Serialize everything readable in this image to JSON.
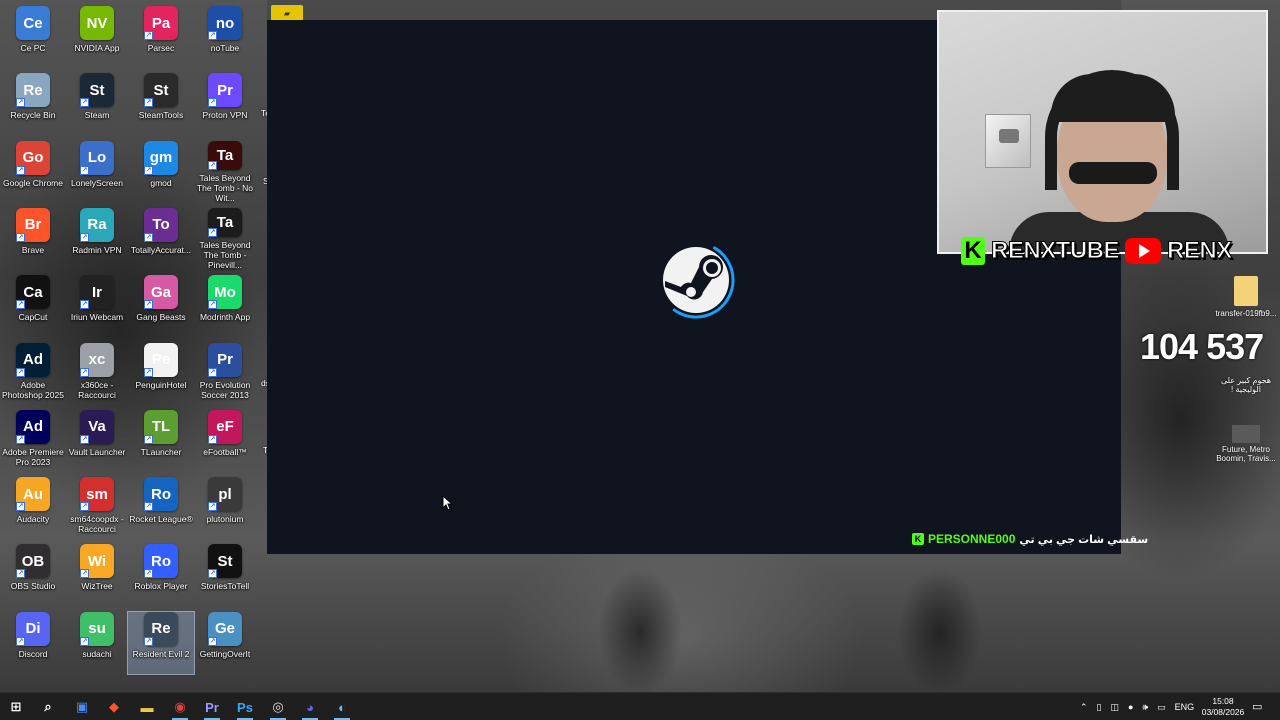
{
  "desktop": {
    "icons": [
      {
        "label": "Ce PC",
        "icon": "computer-icon",
        "color": "#3a7bd5"
      },
      {
        "label": "NVIDIA App",
        "icon": "nvidia-icon",
        "color": "#76b900"
      },
      {
        "label": "Parsec",
        "icon": "parsec-icon",
        "color": "#e3245e"
      },
      {
        "label": "noTube",
        "icon": "notube-icon",
        "color": "#1e4fa8"
      },
      {
        "label": "Recycle Bin",
        "icon": "recycle-bin-icon",
        "color": "#8aa6c1"
      },
      {
        "label": "Steam",
        "icon": "steam-icon",
        "color": "#1b2838"
      },
      {
        "label": "SteamTools",
        "icon": "steamtools-icon",
        "color": "#2a2a2a"
      },
      {
        "label": "Proton VPN",
        "icon": "proton-vpn-icon",
        "color": "#6d4aff"
      },
      {
        "label": "Google Chrome",
        "icon": "chrome-icon",
        "color": "#db4437"
      },
      {
        "label": "LonelyScreen",
        "icon": "lonelyscreen-icon",
        "color": "#3c6fc8"
      },
      {
        "label": "gmod",
        "icon": "gmod-icon",
        "color": "#1e88e5"
      },
      {
        "label": "Tales Beyond The Tomb - No Wit...",
        "icon": "tbtt-icon",
        "color": "#3a0b0b"
      },
      {
        "label": "Brave",
        "icon": "brave-icon",
        "color": "#fb542b"
      },
      {
        "label": "Radmin VPN",
        "icon": "radmin-vpn-icon",
        "color": "#29a8b8"
      },
      {
        "label": "TotallyAccurat...",
        "icon": "tabs-icon",
        "color": "#6a2d91"
      },
      {
        "label": "Tales Beyond The Tomb - Pinevill...",
        "icon": "tbtt-ep1-icon",
        "color": "#1c1c1c"
      },
      {
        "label": "CapCut",
        "icon": "capcut-icon",
        "color": "#111111"
      },
      {
        "label": "Iriun Webcam",
        "icon": "iriun-webcam-icon",
        "color": "#222222"
      },
      {
        "label": "Gang Beasts",
        "icon": "gang-beasts-icon",
        "color": "#d65aa3"
      },
      {
        "label": "Modrinth App",
        "icon": "modrinth-icon",
        "color": "#1bd96a"
      },
      {
        "label": "Adobe Photoshop 2025",
        "icon": "photoshop-icon",
        "color": "#001e36"
      },
      {
        "label": "x360ce - Raccourci",
        "icon": "gamepad-icon",
        "color": "#9aa0a6"
      },
      {
        "label": "PenguinHotel",
        "icon": "penguinhotel-icon",
        "color": "#f2f2f2"
      },
      {
        "label": "Pro Evolution Soccer 2013",
        "icon": "pes2013-icon",
        "color": "#2b4f9e"
      },
      {
        "label": "Adobe Premiere Pro 2023",
        "icon": "premiere-icon",
        "color": "#00005b"
      },
      {
        "label": "Vault Launcher",
        "icon": "vault-launcher-icon",
        "color": "#2b1b55"
      },
      {
        "label": "TLauncher",
        "icon": "tlauncher-icon",
        "color": "#5c9e31"
      },
      {
        "label": "eFootball™",
        "icon": "efootball-icon",
        "color": "#c2185b"
      },
      {
        "label": "Audacity",
        "icon": "audacity-icon",
        "color": "#f5a623"
      },
      {
        "label": "sm64coopdx - Raccourci",
        "icon": "sm64-icon",
        "color": "#d32f2f"
      },
      {
        "label": "Rocket League®",
        "icon": "rocket-league-icon",
        "color": "#1565c0"
      },
      {
        "label": "plutonium",
        "icon": "plutonium-icon",
        "color": "#3a3a3a"
      },
      {
        "label": "OBS Studio",
        "icon": "obs-icon",
        "color": "#302e31"
      },
      {
        "label": "WizTree",
        "icon": "wiztree-icon",
        "color": "#f9a825"
      },
      {
        "label": "Roblox Player",
        "icon": "roblox-icon",
        "color": "#335fff"
      },
      {
        "label": "StoriesToTell",
        "icon": "unreal-icon",
        "color": "#111111"
      },
      {
        "label": "Discord",
        "icon": "discord-icon",
        "color": "#5865f2"
      },
      {
        "label": "sudachi",
        "icon": "sudachi-icon",
        "color": "#3fbf68"
      },
      {
        "label": "Resident Evil 2",
        "icon": "resident-evil-2-icon",
        "color": "#3b4a5a"
      },
      {
        "label": "GettingOverIt",
        "icon": "getting-over-it-icon",
        "color": "#4a90c2"
      }
    ],
    "cut_labels": [
      "Te",
      "S",
      "ds",
      "T"
    ],
    "right_icons": [
      {
        "label": "transfer-019fb9...",
        "icon": "folder-icon"
      },
      {
        "label": "هجوم كبير على الوليجية !",
        "icon": "video-file-icon"
      },
      {
        "label": "Future, Metro Boomin, Travis...",
        "icon": "image-file-icon"
      }
    ]
  },
  "stream": {
    "banner_left": "RENXTUBE",
    "banner_right": "RENX",
    "counter": "104 537",
    "chat_user": "PERSONNE000",
    "chat_message": "سقسي شات جي بي تي"
  },
  "taskbar": {
    "apps": [
      {
        "name": "start",
        "icon": "windows-start-icon"
      },
      {
        "name": "search",
        "icon": "search-icon"
      },
      {
        "name": "store",
        "icon": "store-icon"
      },
      {
        "name": "brave",
        "icon": "brave-icon"
      },
      {
        "name": "files",
        "icon": "folder-icon"
      },
      {
        "name": "chrome",
        "icon": "chrome-icon"
      },
      {
        "name": "premiere",
        "icon": "premiere-icon"
      },
      {
        "name": "photoshop",
        "icon": "photoshop-icon"
      },
      {
        "name": "steamtools",
        "icon": "steamtools-icon"
      },
      {
        "name": "discord",
        "icon": "discord-icon"
      },
      {
        "name": "steam",
        "icon": "steam-icon"
      }
    ],
    "language": "ENG",
    "time": "15:08",
    "date": "03/08/2026"
  },
  "colors": {
    "kick_green": "#53fc18",
    "steam_bg": "#0f141f",
    "taskbar_bg": "#1f1f1f",
    "active_indicator": "#76b9ed"
  }
}
